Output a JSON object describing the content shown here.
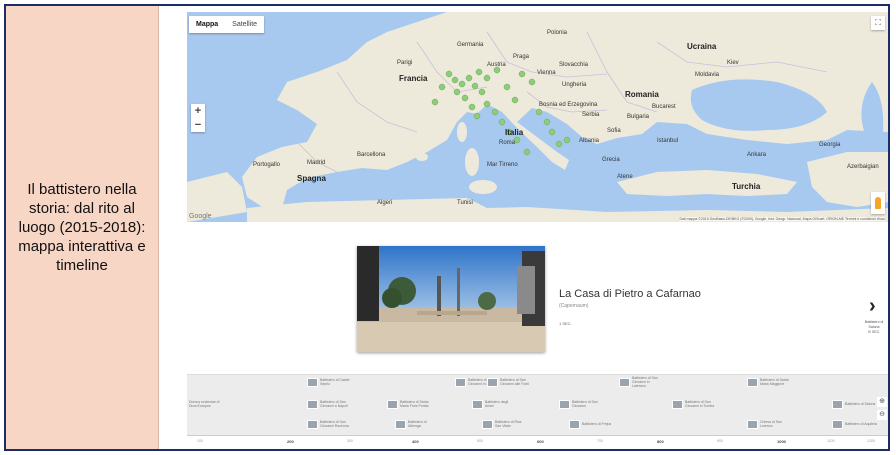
{
  "slide": {
    "caption": "Il battistero nella storia: dal rito al luogo (2015-2018): mappa interattiva e timeline"
  },
  "map": {
    "tabs": [
      {
        "label": "Mappa",
        "active": true
      },
      {
        "label": "Satellite",
        "active": false
      }
    ],
    "zoom_in": "+",
    "zoom_out": "−",
    "fullscreen_icon": "fullscreen-icon",
    "pegman_icon": "pegman-icon",
    "google_logo": "Google",
    "attribution": "Dati mappa ©2019 GeoBasis-DE/BKG (©2009), Google, Inst. Geogr. Nacional, Mapa GISrael, ORION-ME    Termini e condizioni d'uso",
    "labels": [
      {
        "text": "Francia",
        "major": true
      },
      {
        "text": "Italia",
        "major": true
      },
      {
        "text": "Spagna",
        "major": true
      },
      {
        "text": "Romania",
        "major": true
      },
      {
        "text": "Ucraina",
        "major": true
      },
      {
        "text": "Turchia",
        "major": true
      },
      {
        "text": "Bulgaria",
        "major": false
      },
      {
        "text": "Grecia",
        "major": false
      },
      {
        "text": "Portogallo",
        "major": false
      },
      {
        "text": "Georgia",
        "major": false
      },
      {
        "text": "Azerbaigian",
        "major": false
      },
      {
        "text": "Polonia",
        "major": false
      },
      {
        "text": "Germania",
        "major": false
      },
      {
        "text": "Ungheria",
        "major": false
      },
      {
        "text": "Serbia",
        "major": false
      },
      {
        "text": "Madrid",
        "major": false
      },
      {
        "text": "Barcellona",
        "major": false
      },
      {
        "text": "Roma",
        "major": false
      },
      {
        "text": "Parigi",
        "major": false
      },
      {
        "text": "Praga",
        "major": false
      },
      {
        "text": "Vienna",
        "major": false
      },
      {
        "text": "Bucarest",
        "major": false
      },
      {
        "text": "Sofia",
        "major": false
      },
      {
        "text": "Istanbul",
        "major": false
      },
      {
        "text": "Ankara",
        "major": false
      },
      {
        "text": "Atene",
        "major": false
      },
      {
        "text": "Algeri",
        "major": false
      },
      {
        "text": "Tunisi",
        "major": false
      },
      {
        "text": "Mar Tirreno",
        "major": false
      },
      {
        "text": "Kiev",
        "major": false
      },
      {
        "text": "Moldavia",
        "major": false
      },
      {
        "text": "Austria",
        "major": false
      },
      {
        "text": "Slovacchia",
        "major": false
      },
      {
        "text": "Bosnia ed Erzegovina",
        "major": false
      },
      {
        "text": "Albania",
        "major": false
      }
    ]
  },
  "story": {
    "title": "La Casa di Pietro a Cafarnao",
    "subtitle": "(Capernaum)",
    "date": "1 SEC.",
    "next_title": "Battistero di Salona",
    "next_date": "IV SEC."
  },
  "timeline": {
    "events": [
      "Battistero di Castel Seprio",
      "Battistero di San Giovanni in Fonte",
      "Battistero di San Giovanni alle Fonti",
      "Battistero di San Giovanni in Laterano",
      "Battistero di Santa Maria Maggiore",
      "Battistero di Salona",
      "Domus ecclesiae di Dura Europos",
      "Battistero di San Giovanni a Napoli",
      "Battistero di Santa Maria Foris Portas",
      "Battistero degli Ariani",
      "Battistero di San Giovanni",
      "Battistero di San Giovanni in Tumba",
      "Battistero di San Giovanni Ravenna",
      "Battistero di Albenga",
      "Battistero di Riva San Vitale",
      "Battistero di Frejus",
      "Chiesa di San Lorenzo",
      "Battistero di Aquileia"
    ],
    "ticks": [
      "100",
      "200",
      "300",
      "400",
      "500",
      "600",
      "700",
      "800",
      "900",
      "1000",
      "1100",
      "1200"
    ],
    "zoom_in_icon": "zoom-in-icon",
    "zoom_out_icon": "zoom-out-icon"
  },
  "colors": {
    "frame": "#1c2c66",
    "caption_bg": "#f8d6c6",
    "water": "#a8c9ef",
    "land": "#eeeadb",
    "marker": "#8ccc7a"
  }
}
